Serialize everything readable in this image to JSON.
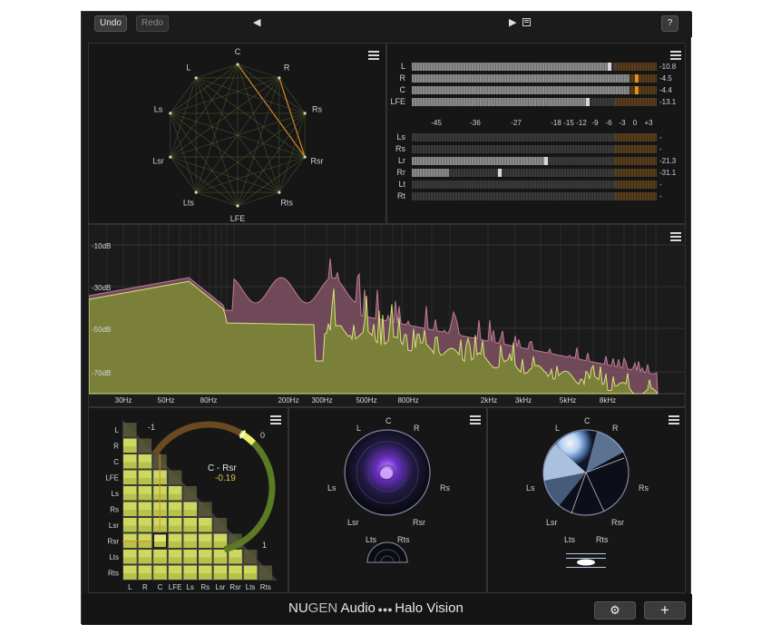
{
  "toolbar": {
    "undo_label": "Undo",
    "redo_label": "Redo",
    "prev_glyph": "◀",
    "play_glyph": "▶",
    "help_label": "?"
  },
  "downmix_map": {
    "speakers": [
      "C",
      "R",
      "Rs",
      "Rsr",
      "Rts",
      "LFE",
      "Lts",
      "Lsr",
      "Ls",
      "L"
    ]
  },
  "meters": {
    "scale_labels": [
      "-45",
      "-36",
      "-27",
      "-18",
      "-15",
      "-12",
      "-9",
      "-6",
      "-3",
      "0",
      "+3"
    ],
    "group1": [
      {
        "label": "L",
        "value": "-10.8",
        "level": 0.8,
        "peak": 0.8
      },
      {
        "label": "R",
        "value": "-4.5",
        "level": 0.89,
        "peak": 0.91
      },
      {
        "label": "C",
        "value": "-4.4",
        "level": 0.89,
        "peak": 0.91
      },
      {
        "label": "LFE",
        "value": "-13.1",
        "level": 0.71,
        "peak": 0.71
      }
    ],
    "group2": [
      {
        "label": "Ls",
        "value": "-",
        "level": 0,
        "peak": 0
      },
      {
        "label": "Rs",
        "value": "-",
        "level": 0,
        "peak": 0
      },
      {
        "label": "Lr",
        "value": "-21.3",
        "level": 0.54,
        "peak": 0.54
      },
      {
        "label": "Rr",
        "value": "-31.1",
        "level": 0.15,
        "peak": 0.35
      },
      {
        "label": "Lt",
        "value": "-",
        "level": 0,
        "peak": 0
      },
      {
        "label": "Rt",
        "value": "-",
        "level": 0,
        "peak": 0
      }
    ]
  },
  "spectrum": {
    "db_labels": [
      "-10dB",
      "-30dB",
      "-50dB",
      "-70dB"
    ],
    "freq_labels": [
      "30Hz",
      "50Hz",
      "80Hz",
      "200Hz",
      "300Hz",
      "500Hz",
      "800Hz",
      "2kHz",
      "3kHz",
      "5kHz",
      "8kHz"
    ]
  },
  "correlation": {
    "row_labels": [
      "L",
      "R",
      "C",
      "LFE",
      "Ls",
      "Rs",
      "Lsr",
      "Rsr",
      "Lts",
      "Rts"
    ],
    "col_labels": [
      "L",
      "R",
      "C",
      "LFE",
      "Ls",
      "Rs",
      "Lsr",
      "Rsr",
      "Lts",
      "Rts"
    ],
    "gauge_min": "-1",
    "gauge_mid": "0",
    "gauge_max": "1",
    "pair_name": "C - Rsr",
    "pair_value": "-0.19"
  },
  "scope1": {
    "labels": [
      "C",
      "L",
      "R",
      "Ls",
      "Rs",
      "Lsr",
      "Rsr",
      "Lts",
      "Rts"
    ]
  },
  "scope2": {
    "labels": [
      "C",
      "L",
      "R",
      "Ls",
      "Rs",
      "Lsr",
      "Rsr",
      "Lts",
      "Rts"
    ]
  },
  "footer": {
    "brand_nu": "NU",
    "brand_gen": "GEN",
    "brand_audio": " Audio",
    "brand_dots": " ●●● ",
    "brand_product": "Halo Vision",
    "settings_glyph": "⚙",
    "add_glyph": "+"
  },
  "colors": {
    "accent_yellow": "#e8f06a",
    "accent_orange": "#d98a2a",
    "spectrum_green": "#8e9e3a",
    "spectrum_pink": "#8e5a6e",
    "scope_purple": "#7a3fd6",
    "scope_blue": "#cfe6ff"
  }
}
